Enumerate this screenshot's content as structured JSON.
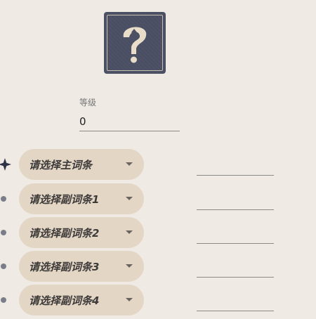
{
  "artifact": {
    "icon": "unknown-item-question-icon",
    "colors": {
      "icon_bg": "#4b5064",
      "icon_frame": "#c9bfae",
      "icon_glyph": "#e8ddc9",
      "pill_bg": "#e3d6c5",
      "page_bg": "#efeae4"
    }
  },
  "level": {
    "label": "等级",
    "value": "0"
  },
  "main_stat": {
    "placeholder": "请选择主词条",
    "value": ""
  },
  "sub_stats": [
    {
      "placeholder": "请选择副词条1",
      "value": ""
    },
    {
      "placeholder": "请选择副词条2",
      "value": ""
    },
    {
      "placeholder": "请选择副词条3",
      "value": ""
    },
    {
      "placeholder": "请选择副词条4",
      "value": ""
    }
  ]
}
